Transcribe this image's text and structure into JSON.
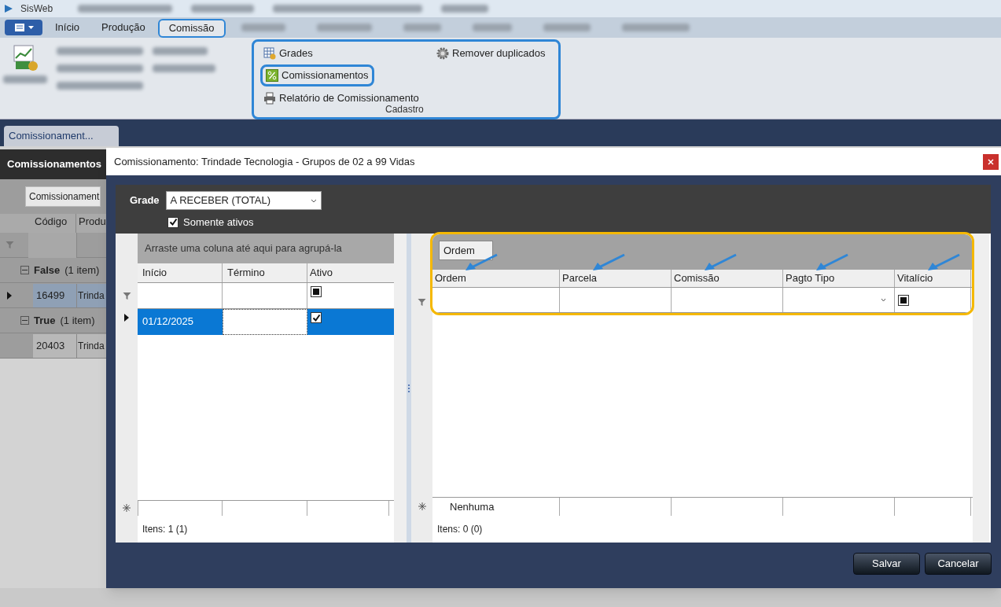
{
  "app": {
    "title": "SisWeb"
  },
  "ribbon_tabs": [
    {
      "label": "Início",
      "selected": false
    },
    {
      "label": "Produção",
      "selected": false
    },
    {
      "label": "Comissão",
      "selected": true
    }
  ],
  "ribbon_group": {
    "label": "Cadastro",
    "items": [
      {
        "label": "Grades",
        "kind": "grid"
      },
      {
        "label": "Comissionamentos",
        "kind": "percent"
      },
      {
        "label": "Relatório de Comissionamento",
        "kind": "printer"
      },
      {
        "label": "Remover duplicados",
        "kind": "gear"
      }
    ]
  },
  "document_tab": {
    "label": "Comissionament..."
  },
  "background_panel": {
    "title": "Comissionamentos",
    "filter_button": "Comissionament",
    "columns": [
      "Código",
      "Produ"
    ],
    "groups": [
      {
        "label": "False",
        "count": "(1 item)",
        "expanded": true,
        "rows": [
          {
            "cells": [
              "16499",
              "Trinda"
            ],
            "selected": true
          }
        ]
      },
      {
        "label": "True",
        "count": "(1 item)",
        "expanded": true,
        "rows": [
          {
            "cells": [
              "20403",
              "Trinda"
            ],
            "selected": false
          }
        ]
      }
    ]
  },
  "dialog": {
    "title": "Comissionamento: Trindade Tecnologia - Grupos de 02 a 99 Vidas",
    "grade": {
      "label": "Grade",
      "value": "A RECEBER (TOTAL)"
    },
    "only_active": {
      "label": "Somente ativos",
      "checked": true
    },
    "left_grid": {
      "group_hint": "Arraste uma coluna até aqui para agrupá-la",
      "columns": [
        "Início",
        "Término",
        "Ativo"
      ],
      "active_filter_indeterminate": true,
      "rows": [
        {
          "start": "01/12/2025",
          "active": true,
          "selected": true
        }
      ],
      "status": "Itens: 1 (1)"
    },
    "right_grid": {
      "group_chips": [
        "Ordem"
      ],
      "lifetime_filter_indeterminate": true,
      "columns": [
        "Ordem",
        "Parcela",
        "Comissão",
        "Pagto Tipo",
        "Vitalício"
      ],
      "new_row_text": "Nenhuma",
      "status": "Itens: 0 (0)"
    },
    "buttons": [
      "Salvar",
      "Cancelar"
    ]
  }
}
